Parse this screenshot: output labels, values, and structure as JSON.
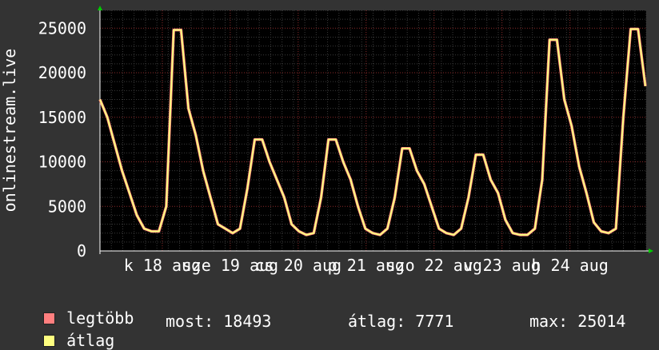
{
  "chart_data": {
    "type": "line",
    "ylabel": "onlinestream.live",
    "ylim": [
      0,
      27000
    ],
    "yticks": [
      0,
      5000,
      10000,
      15000,
      20000,
      25000
    ],
    "xtick_labels": [
      "k 18 aug",
      "sze 19 aug",
      "cs 20 aug",
      "p 21 aug",
      "szo 22 aug",
      "v 23 aug",
      "h 24 aug"
    ],
    "grid": true,
    "series": [
      {
        "name": "legtöbb",
        "color": "#ff7f7f",
        "values": [
          17000,
          15000,
          12000,
          9000,
          6500,
          4000,
          2500,
          2200,
          2200,
          5000,
          24800,
          24800,
          16000,
          13000,
          9000,
          6000,
          3000,
          2500,
          2000,
          2500,
          7000,
          12500,
          12500,
          10000,
          8000,
          6000,
          3000,
          2200,
          1800,
          2000,
          6000,
          12500,
          12500,
          10000,
          8000,
          5000,
          2500,
          2000,
          1800,
          2500,
          6000,
          11500,
          11500,
          9000,
          7500,
          5000,
          2500,
          2000,
          1800,
          2500,
          6000,
          10800,
          10800,
          8000,
          6500,
          3500,
          2000,
          1800,
          1800,
          2500,
          8000,
          23700,
          23700,
          17000,
          14000,
          9500,
          6500,
          3200,
          2200,
          2000,
          2500,
          15000,
          24900,
          24900,
          18500
        ]
      },
      {
        "name": "átlag",
        "color": "#ffff80",
        "values": [
          17000,
          15000,
          12000,
          9000,
          6500,
          4000,
          2500,
          2200,
          2200,
          5000,
          24800,
          24800,
          16000,
          13000,
          9000,
          6000,
          3000,
          2500,
          2000,
          2500,
          7000,
          12500,
          12500,
          10000,
          8000,
          6000,
          3000,
          2200,
          1800,
          2000,
          6000,
          12500,
          12500,
          10000,
          8000,
          5000,
          2500,
          2000,
          1800,
          2500,
          6000,
          11500,
          11500,
          9000,
          7500,
          5000,
          2500,
          2000,
          1800,
          2500,
          6000,
          10800,
          10800,
          8000,
          6500,
          3500,
          2000,
          1800,
          1800,
          2500,
          8000,
          23700,
          23700,
          17000,
          14000,
          9500,
          6500,
          3200,
          2200,
          2000,
          2500,
          15000,
          24900,
          24900,
          18500
        ]
      }
    ]
  },
  "legend": {
    "item1_label": "legtöbb",
    "item1_color": "#ff7f7f",
    "item2_label": "átlag",
    "item2_color": "#ffff80"
  },
  "stats": {
    "most": "most: 18493",
    "atlag": "átlag: 7771",
    "max": "max: 25014"
  }
}
